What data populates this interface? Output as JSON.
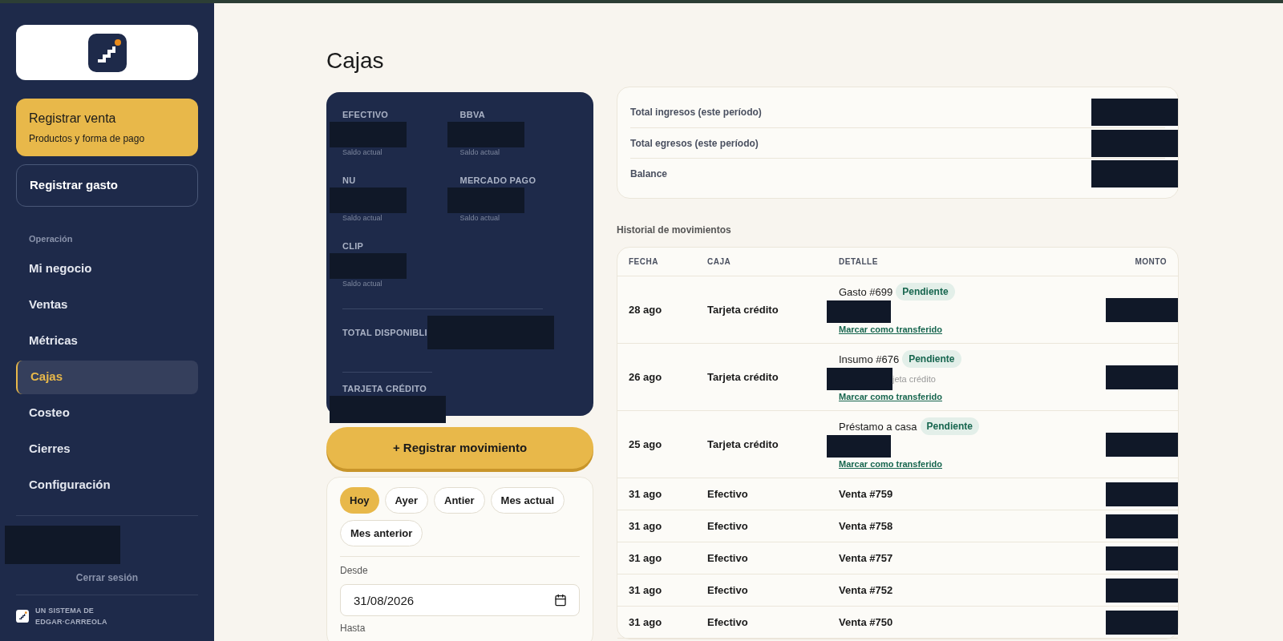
{
  "sidebar": {
    "primary_action": {
      "title": "Registrar venta",
      "subtitle": "Productos y forma de pago"
    },
    "secondary_action": "Registrar gasto",
    "section": "Operación",
    "items": [
      {
        "label": "Mi negocio",
        "selected": false
      },
      {
        "label": "Ventas",
        "selected": false
      },
      {
        "label": "Métricas",
        "selected": false
      },
      {
        "label": "Cajas",
        "selected": true
      },
      {
        "label": "Costeo",
        "selected": false
      },
      {
        "label": "Cierres",
        "selected": false
      },
      {
        "label": "Configuración",
        "selected": false
      }
    ],
    "logout": "Cerrar sesión",
    "footer": [
      "UN SISTEMA DE",
      "EDGAR·CARREOLA"
    ]
  },
  "page_title": "Cajas",
  "accounts": [
    {
      "name": "EFECTIVO",
      "caption": "Saldo actual"
    },
    {
      "name": "BBVA",
      "caption": "Saldo actual"
    },
    {
      "name": "NU",
      "caption": "Saldo actual"
    },
    {
      "name": "MERCADO PAGO",
      "caption": "Saldo actual"
    },
    {
      "name": "CLIP",
      "caption": "Saldo actual"
    }
  ],
  "total_label": "TOTAL DISPONIBLI",
  "credit_label": "TARJETA CRÉDITO",
  "register_button": "+ Registrar movimiento",
  "filters": [
    {
      "label": "Hoy",
      "selected": true
    },
    {
      "label": "Ayer",
      "selected": false
    },
    {
      "label": "Antier",
      "selected": false
    },
    {
      "label": "Mes actual",
      "selected": false
    },
    {
      "label": "Mes anterior",
      "selected": false
    }
  ],
  "from": {
    "label": "Desde",
    "value": "31/08/2026"
  },
  "to": {
    "label": "Hasta"
  },
  "summary": [
    "Total ingresos (este período)",
    "Total egresos (este período)",
    "Balance"
  ],
  "history": {
    "title": "Historial de movimientos",
    "columns": [
      "FECHA",
      "CAJA",
      "DETALLE",
      "MONTO"
    ],
    "rows": [
      {
        "date": "28 ago",
        "box": "Tarjeta crédito",
        "detail": "Gasto #699",
        "status": "Pendiente",
        "link": "Marcar como transferido"
      },
      {
        "date": "26 ago",
        "box": "Tarjeta crédito",
        "detail": "Insumo #676",
        "status": "Pendiente",
        "note": "jeta crédito",
        "link": "Marcar como transferido"
      },
      {
        "date": "25 ago",
        "box": "Tarjeta crédito",
        "detail": "Préstamo a casa",
        "status": "Pendiente",
        "link": "Marcar como transferido"
      },
      {
        "date": "31 ago",
        "box": "Efectivo",
        "detail": "Venta #759"
      },
      {
        "date": "31 ago",
        "box": "Efectivo",
        "detail": "Venta #758"
      },
      {
        "date": "31 ago",
        "box": "Efectivo",
        "detail": "Venta #757"
      },
      {
        "date": "31 ago",
        "box": "Efectivo",
        "detail": "Venta #752"
      },
      {
        "date": "31 ago",
        "box": "Efectivo",
        "detail": "Venta #750"
      }
    ]
  }
}
